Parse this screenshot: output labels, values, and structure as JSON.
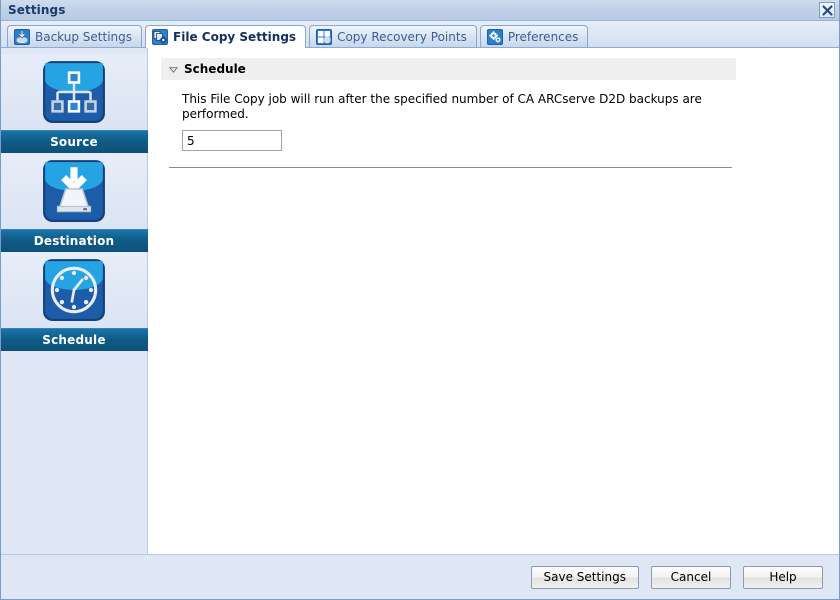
{
  "window": {
    "title": "Settings",
    "close_icon": "close-x-icon"
  },
  "tabs": [
    {
      "label": "Backup Settings",
      "icon": "backup-settings-icon",
      "active": false
    },
    {
      "label": "File Copy Settings",
      "icon": "file-copy-settings-icon",
      "active": true
    },
    {
      "label": "Copy Recovery Points",
      "icon": "copy-recovery-points-icon",
      "active": false
    },
    {
      "label": "Preferences",
      "icon": "preferences-gear-icon",
      "active": false
    }
  ],
  "sidebar": {
    "items": [
      {
        "label": "Source",
        "icon": "source-hierarchy-icon",
        "selected": false
      },
      {
        "label": "Destination",
        "icon": "destination-drive-icon",
        "selected": false
      },
      {
        "label": "Schedule",
        "icon": "schedule-clock-icon",
        "selected": true
      }
    ]
  },
  "main": {
    "panel": {
      "title": "Schedule",
      "collapse_icon": "chevron-down-triangle-icon",
      "description": "This File Copy job will run after the specified number of CA ARCserve D2D backups are performed.",
      "backup_count": {
        "value": "5",
        "placeholder": ""
      }
    }
  },
  "footer": {
    "buttons": [
      {
        "label": "Save Settings"
      },
      {
        "label": "Cancel"
      },
      {
        "label": "Help"
      }
    ]
  },
  "colors": {
    "titlebar": "#c2d1e6",
    "title_text": "#1b3b6b",
    "sidebar_bg": "#dfe7f5",
    "selected_band": "#0f5c87",
    "panel_head": "#efefef",
    "tab_active_text": "#14305c",
    "tab_text": "#3a5f93"
  }
}
